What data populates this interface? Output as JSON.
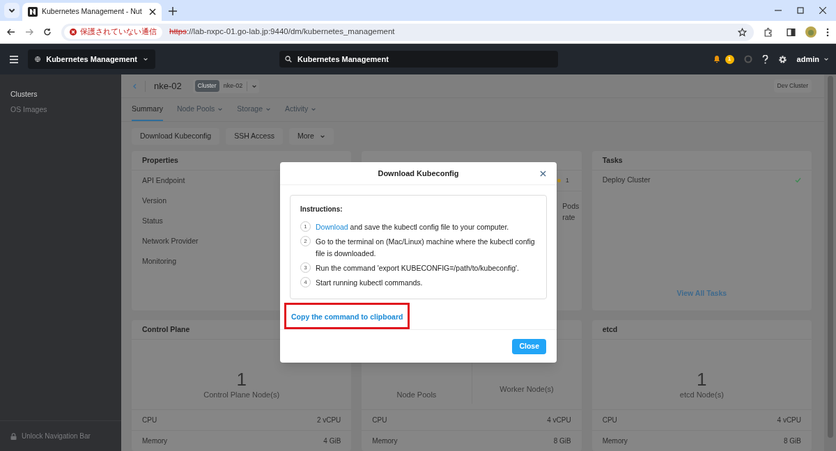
{
  "browser": {
    "tab_title": "Kubernetes Management - Nut",
    "security": "保護されていない通信",
    "url_scheme": "https",
    "url_rest": "://lab-nxpc-01.go-lab.jp:9440/dm/kubernetes_management"
  },
  "app_header": {
    "context": "Kubernetes Management",
    "search": "Kubernetes Management",
    "alert_count": "1",
    "user": "admin"
  },
  "sidebar": {
    "items": [
      {
        "label": "Clusters",
        "selected": true
      },
      {
        "label": "OS Images",
        "selected": false
      }
    ],
    "footer": "Unlock Navigation Bar"
  },
  "cluster_header": {
    "name": "nke-02",
    "tag": "Cluster",
    "selector": "nke-02",
    "badge": "Dev Cluster"
  },
  "tabs": [
    {
      "label": "Summary",
      "selected": true,
      "dropdown": false
    },
    {
      "label": "Node Pools",
      "selected": false,
      "dropdown": true
    },
    {
      "label": "Storage",
      "selected": false,
      "dropdown": true
    },
    {
      "label": "Activity",
      "selected": false,
      "dropdown": true
    }
  ],
  "actions": [
    {
      "label": "Download Kubeconfig",
      "dropdown": false
    },
    {
      "label": "SSH Access",
      "dropdown": false
    },
    {
      "label": "More",
      "dropdown": true
    }
  ],
  "properties": {
    "title": "Properties",
    "rows": [
      "API Endpoint",
      "Version",
      "Status",
      "Network Provider",
      "Monitoring"
    ]
  },
  "middle_card": {
    "alert_count": "1",
    "lines": [
      "Pods",
      "rate"
    ]
  },
  "tasks": {
    "title": "Tasks",
    "items": [
      {
        "label": "Deploy Cluster",
        "done": true
      }
    ],
    "link": "View All Tasks"
  },
  "resource_cards": [
    {
      "title": "Control Plane",
      "stats": [
        {
          "count": "1",
          "label": "Control Plane Node(s)"
        }
      ],
      "rows": [
        {
          "label": "CPU",
          "value": "2 vCPU"
        },
        {
          "label": "Memory",
          "value": "4 GiB"
        }
      ]
    },
    {
      "stats": [
        {
          "label": "Node Pools"
        },
        {
          "label": "Worker Node(s)"
        }
      ],
      "rows": [
        {
          "label": "CPU",
          "value": "4 vCPU"
        },
        {
          "label": "Memory",
          "value": "8 GiB"
        }
      ]
    },
    {
      "title": "etcd",
      "stats": [
        {
          "count": "1",
          "label": "etcd Node(s)"
        }
      ],
      "rows": [
        {
          "label": "CPU",
          "value": "4 vCPU"
        },
        {
          "label": "Memory",
          "value": "8 GiB"
        }
      ]
    }
  ],
  "modal": {
    "title": "Download Kubeconfig",
    "heading": "Instructions:",
    "steps": [
      {
        "number": "1",
        "link": "Download",
        "text": " and save the kubectl config file to your computer."
      },
      {
        "number": "2",
        "text": "Go to the terminal on (Mac/Linux) machine where the kubectl config file is downloaded."
      },
      {
        "number": "3",
        "text": "Run the command 'export KUBECONFIG=/path/to/kubeconfig'."
      },
      {
        "number": "4",
        "text": "Start running kubectl commands."
      }
    ],
    "copy_link": "Copy the command to clipboard",
    "copy_highlighted": true,
    "close_button": "Close"
  }
}
